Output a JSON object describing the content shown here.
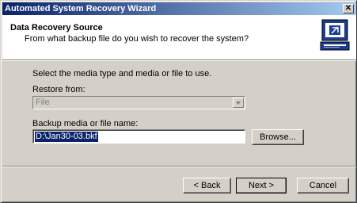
{
  "window": {
    "title": "Automated System Recovery Wizard",
    "close_glyph": "✕"
  },
  "header": {
    "title": "Data Recovery Source",
    "subtitle": "From what backup file do you wish to recover the system?",
    "icon": "computer-restore-icon"
  },
  "body": {
    "instruction": "Select the media type and media or file to use.",
    "restore_from_label": "Restore from:",
    "restore_from_value": "File",
    "backup_label": "Backup media or file name:",
    "backup_value": "D:\\Jan30-03.bkf",
    "browse_label": "Browse..."
  },
  "footer": {
    "back_label": "< Back",
    "next_label": "Next >",
    "cancel_label": "Cancel"
  },
  "colors": {
    "titlebar_start": "#0a246a",
    "titlebar_end": "#a6caf0",
    "face": "#d4d0c8",
    "selection": "#0a246a"
  }
}
